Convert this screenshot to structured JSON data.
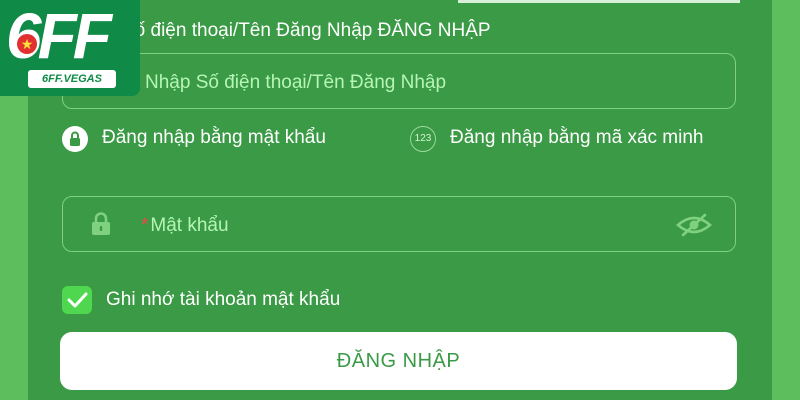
{
  "logo": {
    "text": "6FF",
    "domain": "6FF.VEGAS"
  },
  "form": {
    "section_title": "Số điện thoại/Tên Đăng Nhập ĐĂNG NHẬP",
    "username_placeholder": "Nhập Số điện thoại/Tên Đăng Nhập",
    "login_method_password": "Đăng nhập bằng mật khẩu",
    "login_method_code": "Đăng nhập bằng mã xác minh",
    "code_icon_text": "123",
    "password_required_mark": "*",
    "password_placeholder": "Mật khẩu",
    "remember_label": "Ghi nhớ tài khoản mật khẩu",
    "remember_checked": true,
    "submit_label": "ĐĂNG NHẬP"
  },
  "colors": {
    "panel": "#3a9a45",
    "background": "#5cbe5c",
    "accent": "#4fd84f",
    "required": "#e94b4b"
  },
  "icons": [
    "lock-icon",
    "numeric-code-icon",
    "eye-slash-icon",
    "checkmark-icon",
    "star-icon"
  ]
}
